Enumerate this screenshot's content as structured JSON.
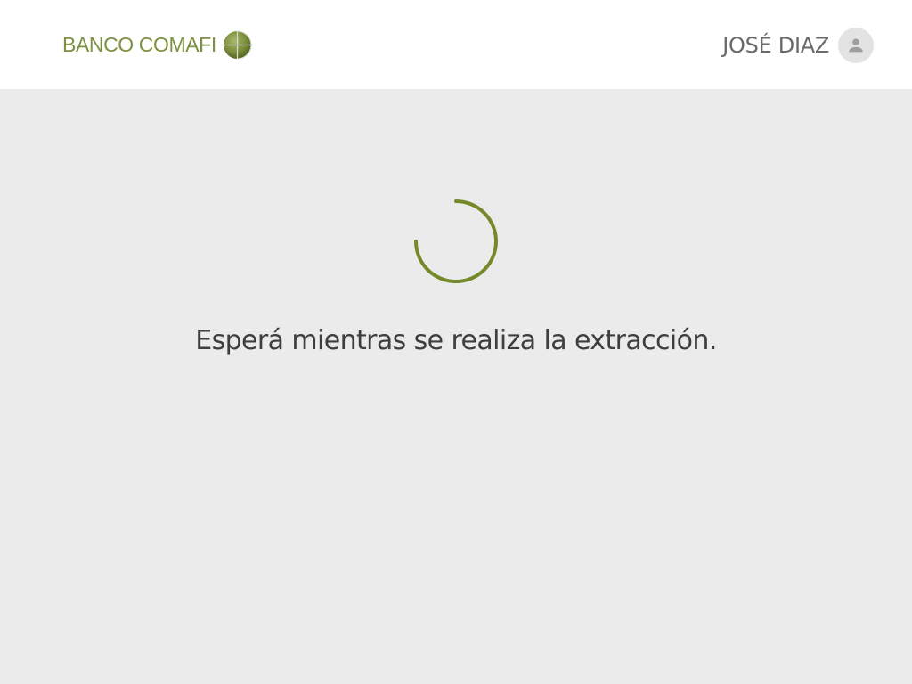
{
  "header": {
    "brand": "BANCO COMAFI",
    "brand_color": "#7d9140",
    "logo_icon": "comafi-globe-icon",
    "user_name": "JOSÉ DIAZ",
    "avatar_icon": "user-icon"
  },
  "main": {
    "spinner_icon": "loading-spinner-icon",
    "accent_color": "#76892a",
    "message": "Esperá mientras se realiza la extracción."
  }
}
